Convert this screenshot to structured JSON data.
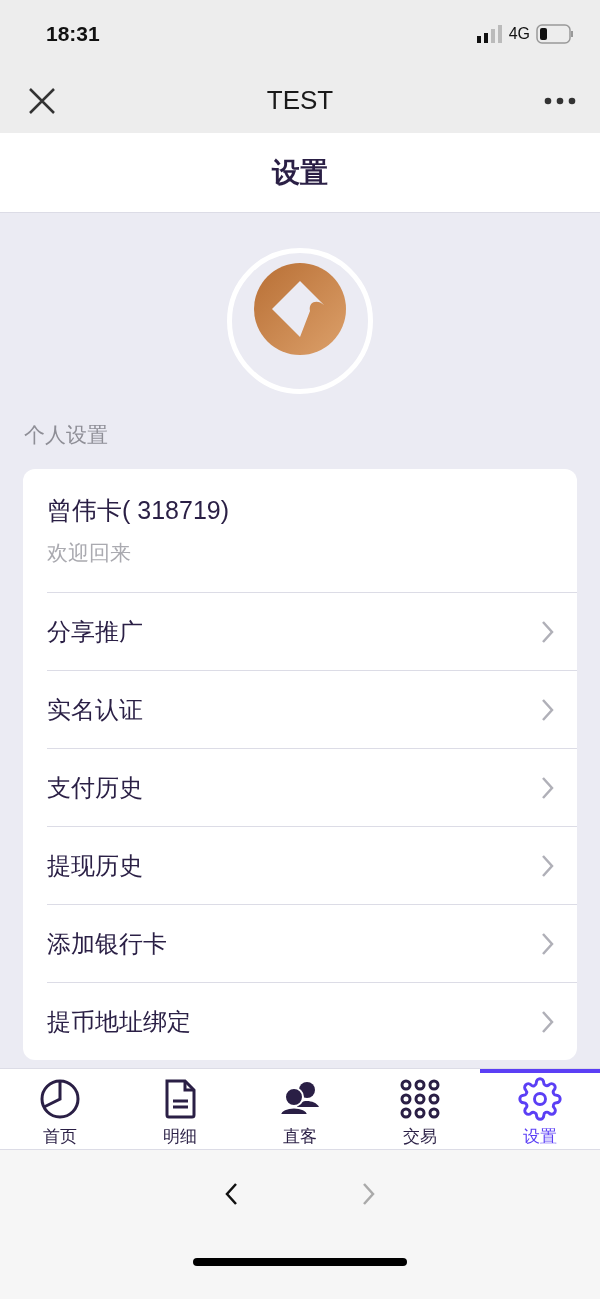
{
  "status_bar": {
    "time": "18:31",
    "network": "4G"
  },
  "nav_bar": {
    "title": "TEST"
  },
  "header": {
    "title": "设置"
  },
  "avatar": {
    "kind": "logo"
  },
  "section": {
    "title": "个人设置"
  },
  "profile": {
    "name": "曾伟卡( 318719)",
    "subtitle": "欢迎回来"
  },
  "menu_items": [
    {
      "label": "分享推广"
    },
    {
      "label": "实名认证"
    },
    {
      "label": "支付历史"
    },
    {
      "label": "提现历史"
    },
    {
      "label": "添加银行卡"
    },
    {
      "label": "提币地址绑定"
    }
  ],
  "tabs": [
    {
      "label": "首页",
      "kind": "chart",
      "selected": false
    },
    {
      "label": "明细",
      "kind": "document",
      "selected": false
    },
    {
      "label": "直客",
      "kind": "users",
      "selected": false
    },
    {
      "label": "交易",
      "kind": "grid",
      "selected": false
    },
    {
      "label": "设置",
      "kind": "gear",
      "selected": true
    }
  ],
  "browser_nav": {
    "back_disabled": false,
    "forward_disabled": true
  }
}
